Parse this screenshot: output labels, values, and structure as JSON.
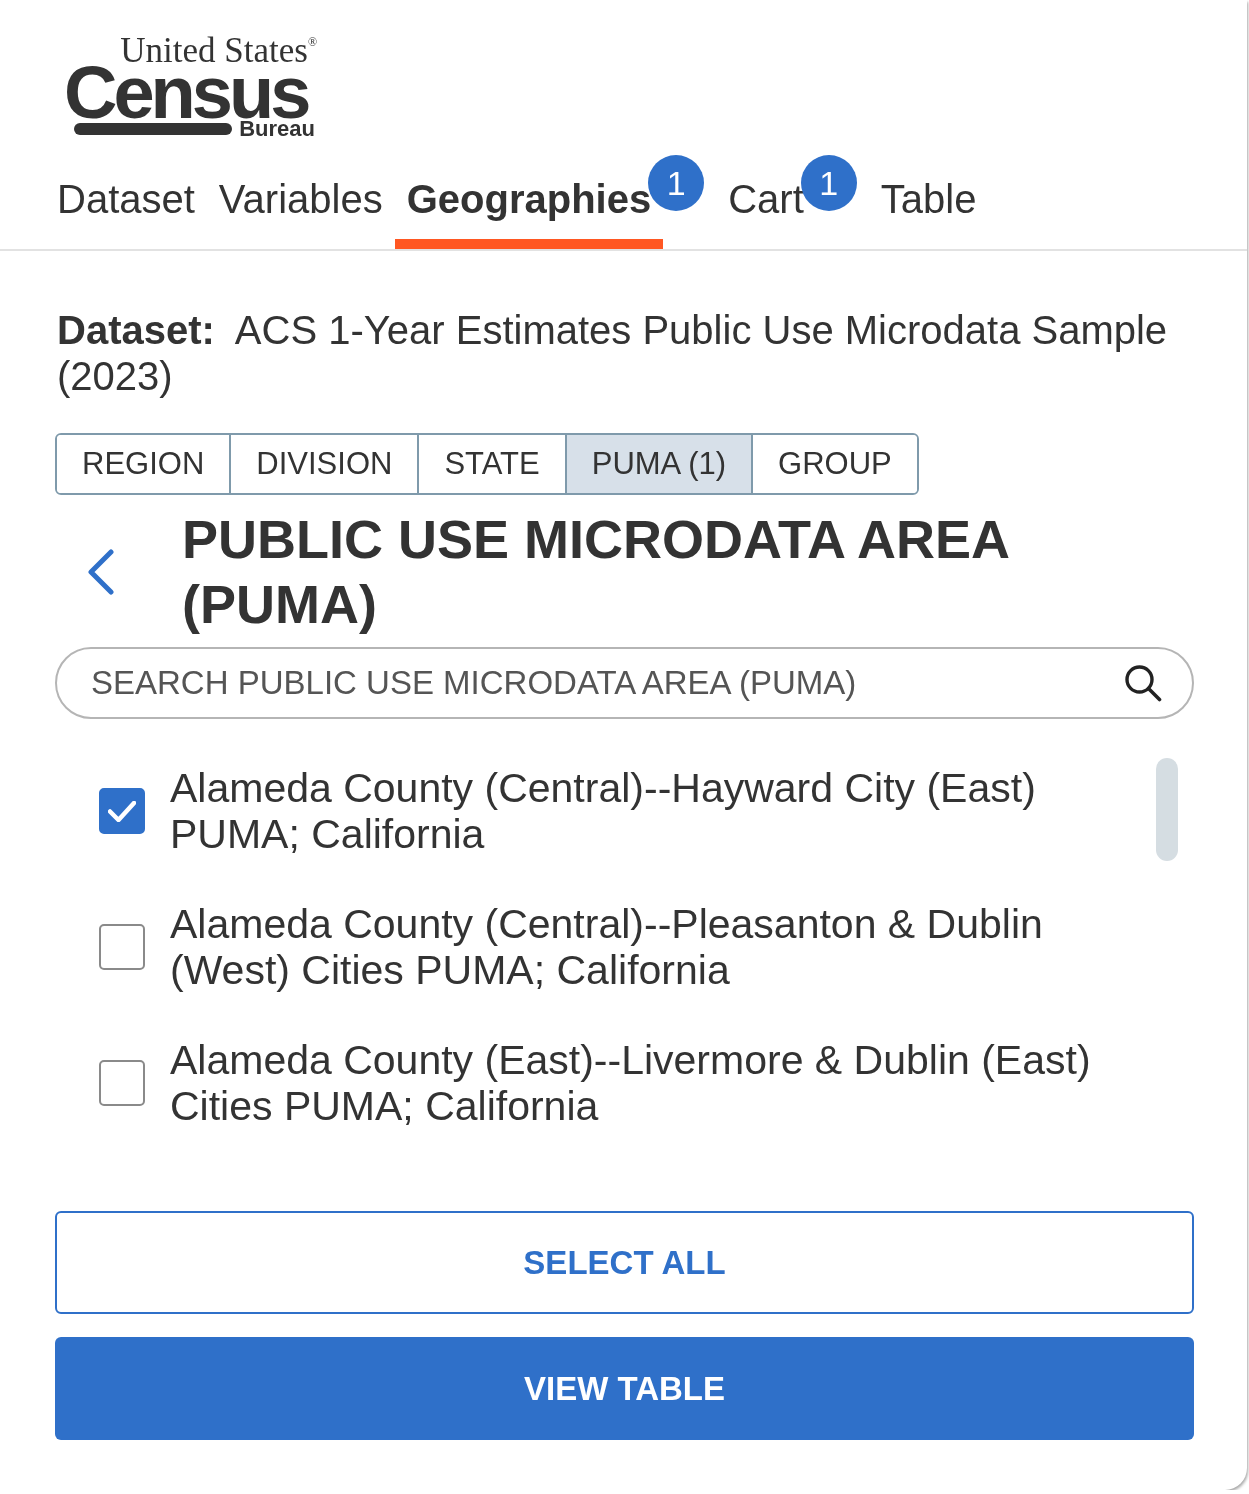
{
  "logo": {
    "line_1": "United States$^{®}$",
    "wordmark": "Census",
    "line_3": "Bureau"
  },
  "tabs": [
    {
      "label": "Dataset",
      "selected": false
    },
    {
      "label": "Variables",
      "selected": false
    },
    {
      "label": "Geographies",
      "selected": true,
      "badge": "1"
    },
    {
      "label": "Cart",
      "selected": false,
      "badge": "1"
    },
    {
      "label": "Table",
      "selected": false
    }
  ],
  "dataset": {
    "label": "Dataset:",
    "value": "ACS 1-Year Estimates Public Use Microdata Sample (2023)"
  },
  "geo_levels": [
    {
      "label": "REGION",
      "selected": false
    },
    {
      "label": "DIVISION",
      "selected": false
    },
    {
      "label": "STATE",
      "selected": false
    },
    {
      "label": "PUMA (1)",
      "selected": true
    },
    {
      "label": "GROUP",
      "selected": false
    }
  ],
  "heading": "PUBLIC USE MICRODATA AREA (PUMA)",
  "search": {
    "placeholder": "SEARCH PUBLIC USE MICRODATA AREA (PUMA)"
  },
  "items": [
    {
      "label": "Alameda County (Central)--Hayward City (East) PUMA; California",
      "checked": true
    },
    {
      "label": "Alameda County (Central)--Pleasanton & Dublin (West) Cities PUMA; California",
      "checked": false
    },
    {
      "label": "Alameda County (East)--Livermore & Dublin (East) Cities PUMA; California",
      "checked": false
    }
  ],
  "buttons": [
    {
      "label": "SELECT ALL",
      "kind": "outline"
    },
    {
      "label": "VIEW TABLE",
      "kind": "primary"
    }
  ]
}
